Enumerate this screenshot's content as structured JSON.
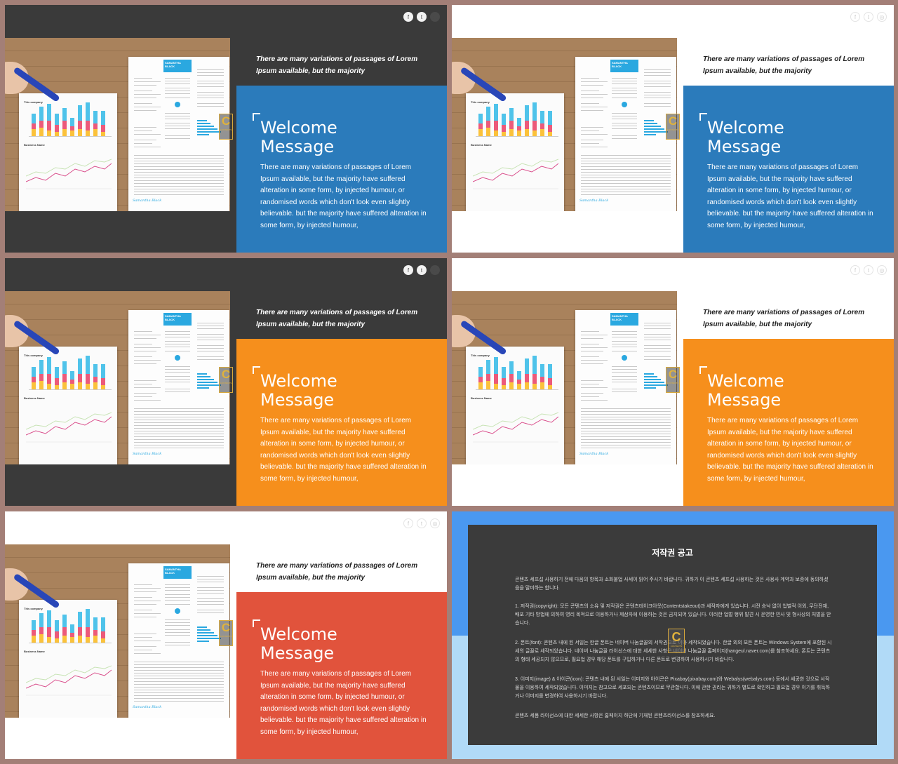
{
  "slides": [
    {
      "id": 1,
      "theme": "dark",
      "panel_color": "#2b7bbb"
    },
    {
      "id": 2,
      "theme": "light",
      "panel_color": "#2b7bbb"
    },
    {
      "id": 3,
      "theme": "dark",
      "panel_color": "#f68f1c"
    },
    {
      "id": 4,
      "theme": "light",
      "panel_color": "#f68f1c"
    },
    {
      "id": 5,
      "theme": "light",
      "panel_color": "#e1533c"
    }
  ],
  "common": {
    "quote": "There are many variations of passages of Lorem Ipsum available, but the majority",
    "welcome_line1": "Welcome",
    "welcome_line2": "Message",
    "body": "There are many variations of passages of Lorem Ipsum available, but the majority have suffered alteration in some form, by injected humour, or randomised words which don't look even slightly believable. but the majority have suffered alteration in some form, by injected humour,",
    "photo_icons": [
      "pen-icon",
      "hand-icon"
    ],
    "top_icons": [
      "facebook-icon",
      "twitter-icon",
      "instagram-icon"
    ],
    "badge_letter": "C",
    "badge_text": "CONTENTS",
    "resume_name": "SAMANTHA BLACK",
    "chart_title": "This company",
    "chart_title2": "Business Name",
    "signature": "Samantha Black"
  },
  "colors": {
    "blue": "#2b7bbb",
    "orange": "#f68f1c",
    "red": "#e1533c",
    "dark": "#3a3a3a",
    "light": "#ffffff",
    "copyright_top": "#4a98f0",
    "copyright_bottom": "#b1daf7"
  },
  "copyright": {
    "title": "저작권 공고",
    "p1": "콘텐츠 세프섭 사용하기 전에 다음의 항목과 소화불업 사세이 읽어 주시기 바랍니다. 귀하가 이 콘텐츠 세프섭 사용하는 것은 사용사 계약과 보증에 동의하셨음을 말미하는 합니다.",
    "p2": "1. 저작권(copyright): 모든 콘텐츠의 소유 및 저작권은 콘텐츠테이크아웃(Contentstakeout)과 세작자에게 있습니다. 시전 승낙 없이 업벌적 이외, 무단전재, 배포 기타 방법에 의하여 영리 목적으로 이용하거나 제삼자에 이용하는 것은 금지되어 있습니다. 이러한 업벌 행위 발견 시 운영한 민사 및 형사상의 처벌을 받습니다.",
    "p3": "2. 폰트(font): 콘텐츠 내에 된 서일는 한글 폰트는 네이버 나눔글꼴의 서작권으로 이아 세작되었습니다. 한글 외의 모든 폰트는 Windows System에 포함된 시세의 글꼴로 세작되었습니다. 네이버 나눔글꼴 라이선스에 대한 세세한 사항은 네이버 나눔글꼴 홈페이지(hangeul.naver.com)를 참조하세요. 폰트는 콘텐츠의 형태 세공되지 않으므로, 필요업 경우 해당 폰트를 구입하거나 다른 폰트로 변경하여 사용하시기 바랍니다.",
    "p4": "3. 이미지(image) & 아이콘(icon): 콘텐츠 내에 된 서일는 이미지와 아이콘은 Pixabay(pixabay.com)와 Webalys(webalys.com) 등에서 세공한 것으로 서작물을 이용하여 세작되었습니다. 이미지는 참고으로 세포되는 콘텐츠이므로 무관합니다. 이에 관한 권리는 귀하가 별도로 확인하고 필요업 경우 이기를 취득하거나 이미지를 변경하여 사용하시기 바랍니다.",
    "p5": "콘텐츠 세품 라이선스에 대한 세세한 사항은 홈페이지 하단에 기재된 콘텐츠라이선스를 참조하세요."
  }
}
